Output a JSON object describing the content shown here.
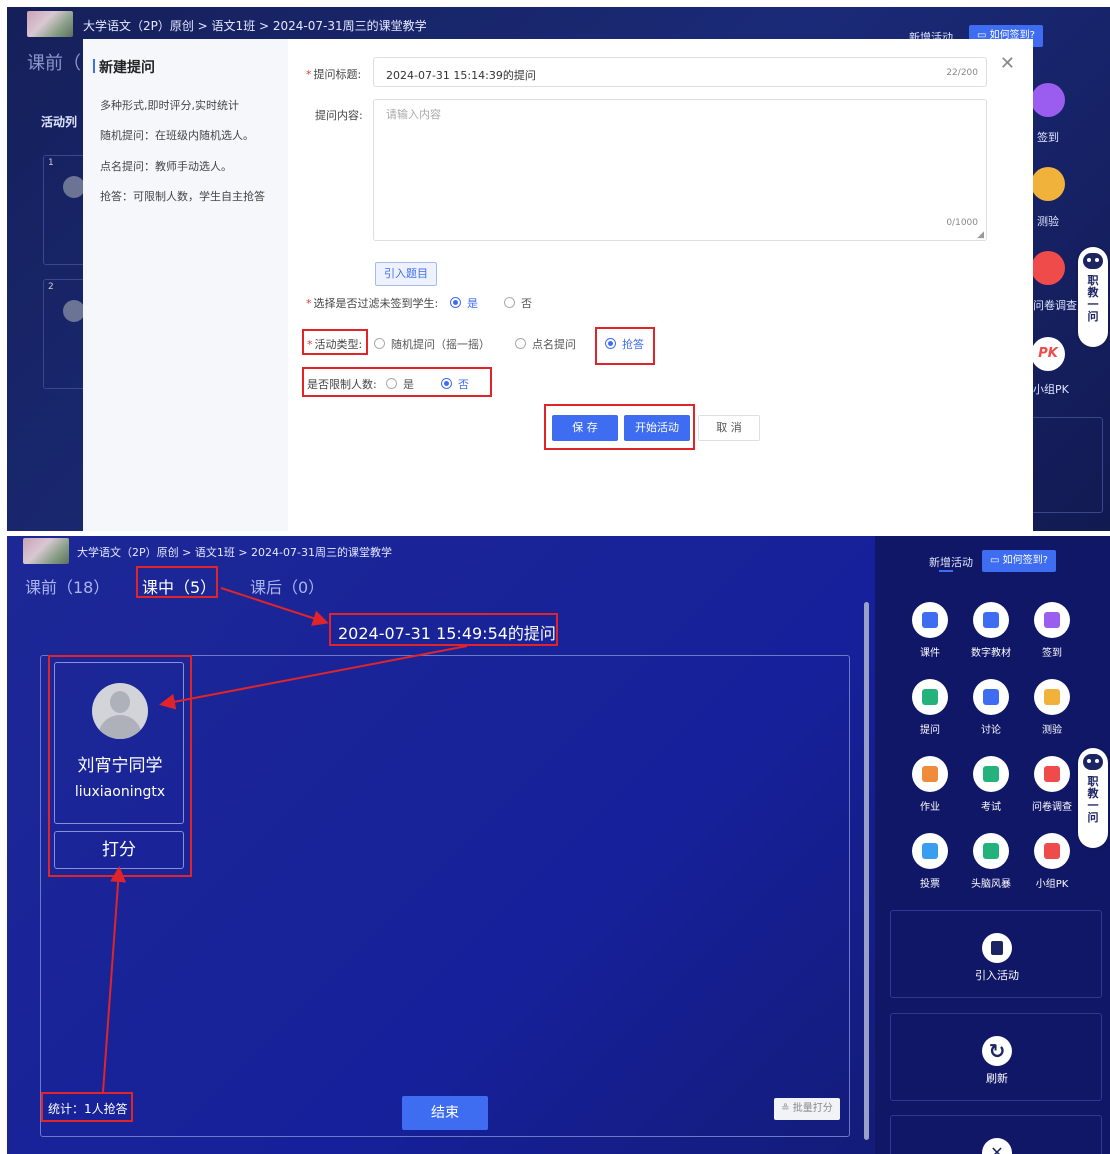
{
  "breadcrumb": "大学语文（2P）原创 > 语文1班 > 2024-07-31周三的课堂教学",
  "header": {
    "new_activity": "新增活动",
    "how_to_sign": "如何签到?"
  },
  "top": {
    "bg_tab": "课前（",
    "bg_section": "活动列",
    "bg_cards": [
      "1",
      "2"
    ],
    "side_labels": [
      "签到",
      "测验",
      "问卷调查",
      "小组PK"
    ],
    "pk_text": "PK",
    "modal": {
      "title": "新建提问",
      "descriptions": [
        "多种形式,即时评分,实时统计",
        "随机提问：在班级内随机选人。",
        "点名提问：教师手动选人。",
        "抢答：可限制人数，学生自主抢答"
      ],
      "title_label": "提问标题:",
      "title_value": "2024-07-31 15:14:39的提问",
      "title_count": "22/200",
      "content_label": "提问内容:",
      "content_placeholder": "请输入内容",
      "content_count": "0/1000",
      "import_label": "引入题目",
      "filter_label": "选择是否过滤未签到学生:",
      "filter_options": [
        "是",
        "否"
      ],
      "filter_selected": "是",
      "type_label": "活动类型:",
      "type_options": [
        "随机提问（摇一摇）",
        "点名提问",
        "抢答"
      ],
      "type_selected": "抢答",
      "limit_label": "是否限制人数:",
      "limit_options": [
        "是",
        "否"
      ],
      "limit_selected": "否",
      "save": "保 存",
      "start": "开始活动",
      "cancel": "取 消"
    }
  },
  "robot_text": "职\n教\n一\n问",
  "bottom": {
    "tabs": [
      "课前（18）",
      "课中（5）",
      "课后（0）"
    ],
    "question_title": "2024-07-31 15:49:54的提问",
    "student_name": "刘宵宁同学",
    "student_id": "liuxiaoningtx",
    "score_btn": "打分",
    "stats": "统计：1人抢答",
    "end_btn": "结束",
    "batch_btn": "批量打分",
    "activities": [
      {
        "label": "课件",
        "color": "#3f6df2"
      },
      {
        "label": "数字教材",
        "color": "#3f6df2"
      },
      {
        "label": "签到",
        "color": "#9b5cf0"
      },
      {
        "label": "提问",
        "color": "#23b27c"
      },
      {
        "label": "讨论",
        "color": "#3f6df2"
      },
      {
        "label": "测验",
        "color": "#f0b23a"
      },
      {
        "label": "作业",
        "color": "#f08b3a"
      },
      {
        "label": "考试",
        "color": "#23b27c"
      },
      {
        "label": "问卷调查",
        "color": "#ef4b4b"
      },
      {
        "label": "投票",
        "color": "#3a9ef0"
      },
      {
        "label": "头脑风暴",
        "color": "#23b27c"
      },
      {
        "label": "小组PK",
        "color": "#ef4b4b"
      }
    ],
    "import_activity": "引入活动",
    "refresh": "刷新"
  }
}
